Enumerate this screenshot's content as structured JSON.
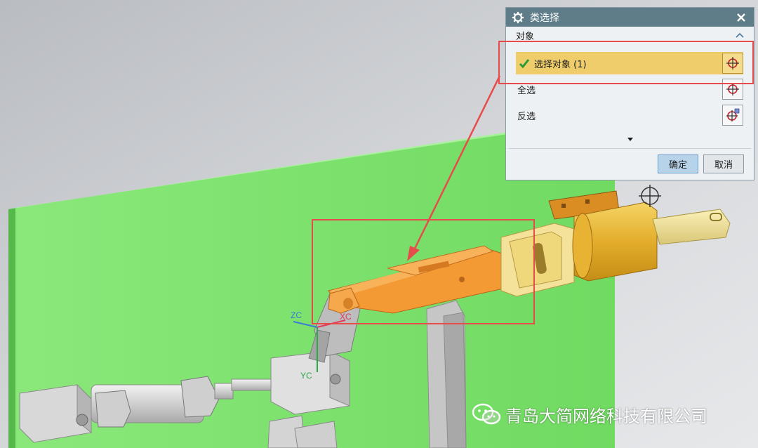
{
  "dialog": {
    "title": "类选择",
    "section_label": "对象",
    "rows": [
      {
        "label": "选择对象 (1)",
        "selected": true
      },
      {
        "label": "全选"
      },
      {
        "label": "反选"
      }
    ],
    "ok_label": "确定",
    "cancel_label": "取消"
  },
  "axes": {
    "zc": "ZC",
    "xc": "XC",
    "yc": "YC"
  },
  "watermark": {
    "text": "青岛大简网络科技有限公司"
  },
  "colors": {
    "title_bar": "#5f7d88",
    "selected_row": "#efcd6a",
    "highlight": "#e84b4b",
    "plate": "#7be36b",
    "selected_part": "#f09a3a",
    "brass": "#e6b83a"
  },
  "icons": [
    "gear-icon",
    "close-icon",
    "collapse-chevron-icon",
    "check-icon",
    "crosshair-icon",
    "expand-arrow-icon",
    "wechat-icon"
  ]
}
